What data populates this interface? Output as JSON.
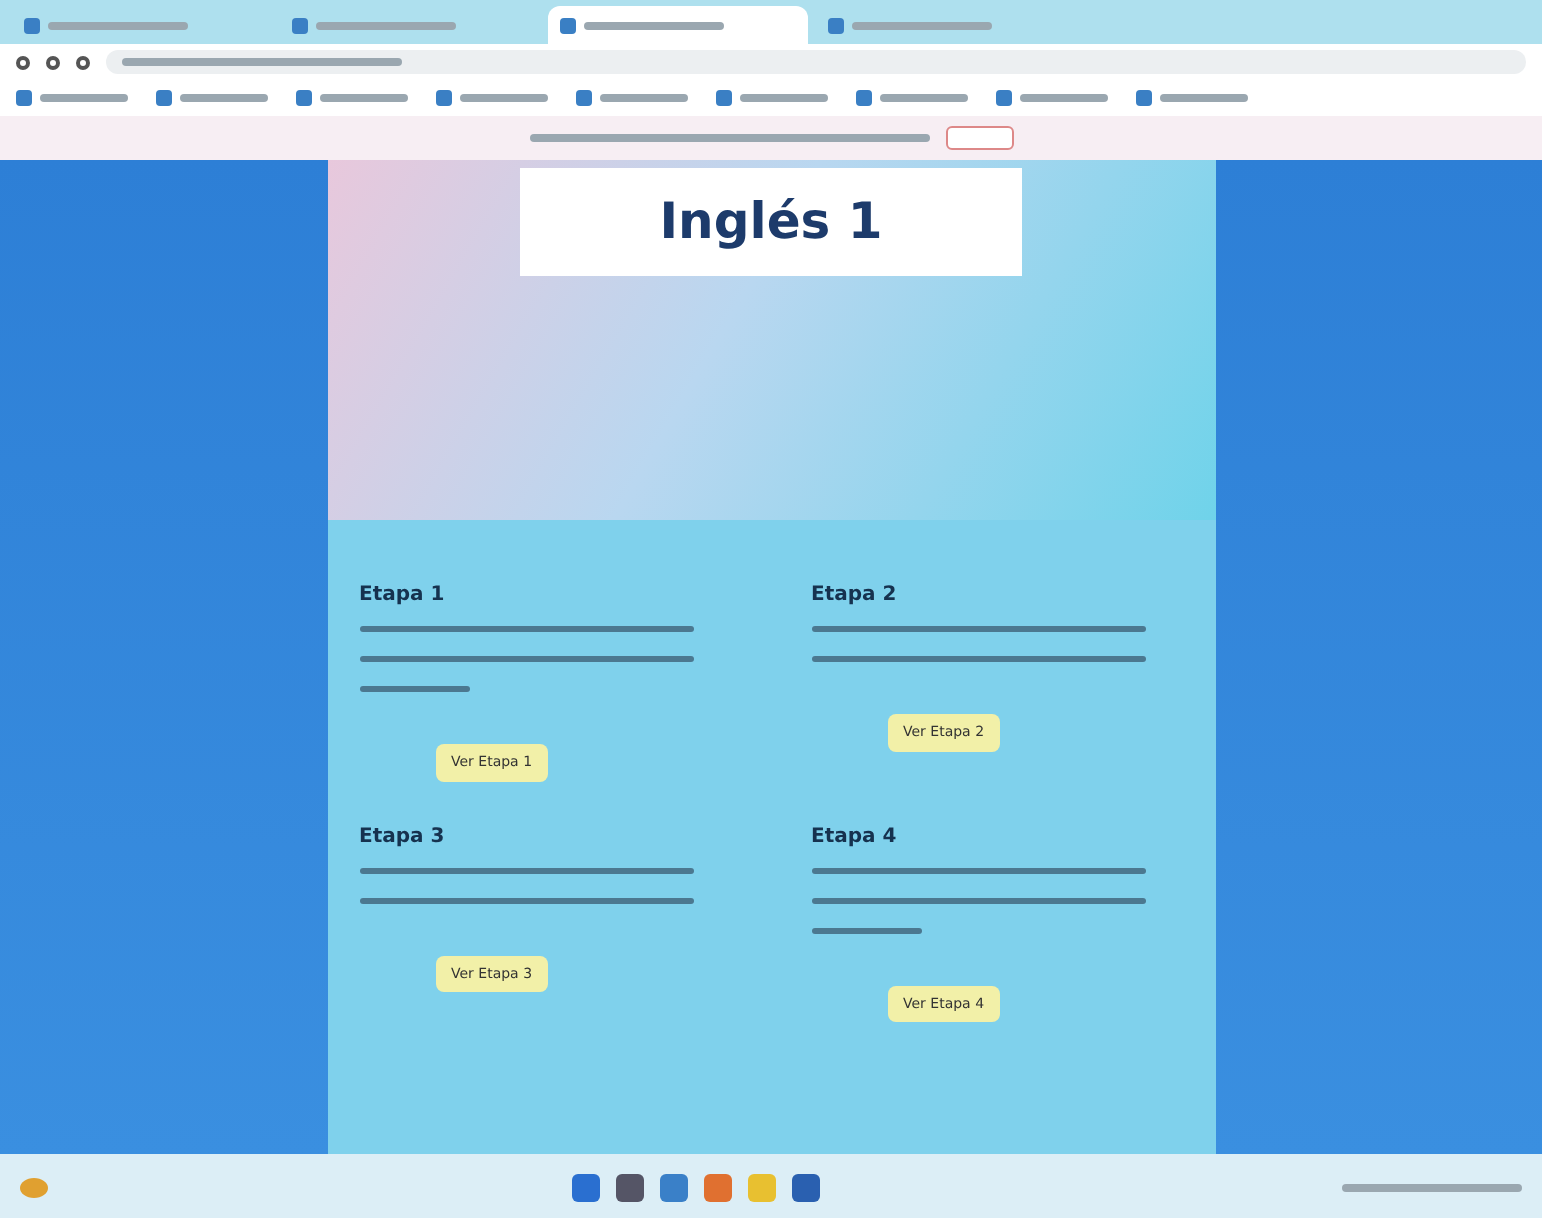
{
  "browser": {
    "tabs": [
      {
        "selected": false
      },
      {
        "selected": false
      },
      {
        "selected": true
      },
      {
        "selected": false
      }
    ]
  },
  "page": {
    "title": "Inglés 1",
    "stages": [
      {
        "heading": "Etapa 1",
        "button": "Ver Etapa 1"
      },
      {
        "heading": "Etapa 2",
        "button": "Ver Etapa 2"
      },
      {
        "heading": "Etapa 3",
        "button": "Ver Etapa 3"
      },
      {
        "heading": "Etapa 4",
        "button": "Ver Etapa 4"
      }
    ]
  }
}
